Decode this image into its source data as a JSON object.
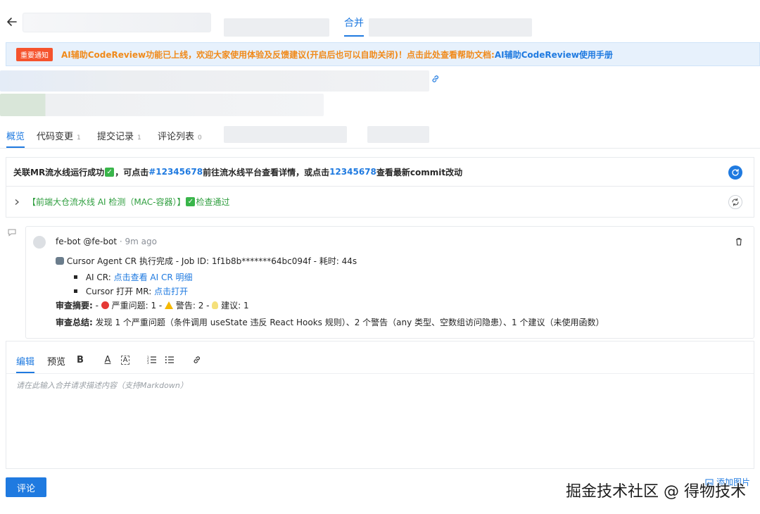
{
  "header": {
    "merge_tab": "合并"
  },
  "notice": {
    "badge": "重要通知",
    "text": "AI辅助CodeReview功能已上线，欢迎大家使用体验及反馈建议(开启后也可以自助关闭)！点击此处查看帮助文档:",
    "link": "AI辅助CodeReview使用手册"
  },
  "tabs": [
    {
      "label": "概览",
      "count": ""
    },
    {
      "label": "代码变更",
      "count": "1"
    },
    {
      "label": "提交记录",
      "count": "1"
    },
    {
      "label": "评论列表",
      "count": "0"
    }
  ],
  "pipeline": {
    "text_a": "关联MR流水线运行成功",
    "text_b": "，可点击",
    "link_1": "#12345678",
    "text_c": " 前往流水线平台查看详情，或点击",
    "link_2": "12345678",
    "text_d": "查看最新commit改动"
  },
  "ai_check": {
    "label": "【前端大仓流水线 AI 检测（MAC-容器）】",
    "result": " 检查通过"
  },
  "comment": {
    "author": "fe-bot @fe-bot",
    "time": " · 9m ago",
    "headline": " Cursor Agent CR 执行完成 - Job ID: 1f1b8b*******64bc094f - 耗时: 44s",
    "bullet_1_label": "AI CR: ",
    "bullet_1_link": "点击查看 AI CR 明细",
    "bullet_2_label": "Cursor 打开 MR: ",
    "bullet_2_link": "点击打开",
    "summary_label": "审查摘要:",
    "summary_a": " - ",
    "summary_b": " 严重问题: 1 - ",
    "summary_c": " 警告: 2 - ",
    "summary_d": " 建议: 1",
    "conclusion_label": "审查总结:",
    "conclusion_text": " 发现 1 个严重问题（条件调用 useState 违反 React Hooks 规则）、2 个警告（any 类型、空数组访问隐患）、1 个建议（未使用函数）"
  },
  "editor": {
    "tab_edit": "编辑",
    "tab_preview": "预览",
    "bold": "B",
    "font_color": "A",
    "bg_color": "A",
    "placeholder": "请在此输入合并请求描述内容（支持Markdown）"
  },
  "footer": {
    "submit": "评论",
    "add_image": "添加图片",
    "watermark": "掘金技术社区 @ 得物技术"
  },
  "colors": {
    "accent": "#1f7ae0",
    "notice_orange": "#f08a1a",
    "badge_red": "#f5532d",
    "success_green": "#2f9e3f"
  }
}
